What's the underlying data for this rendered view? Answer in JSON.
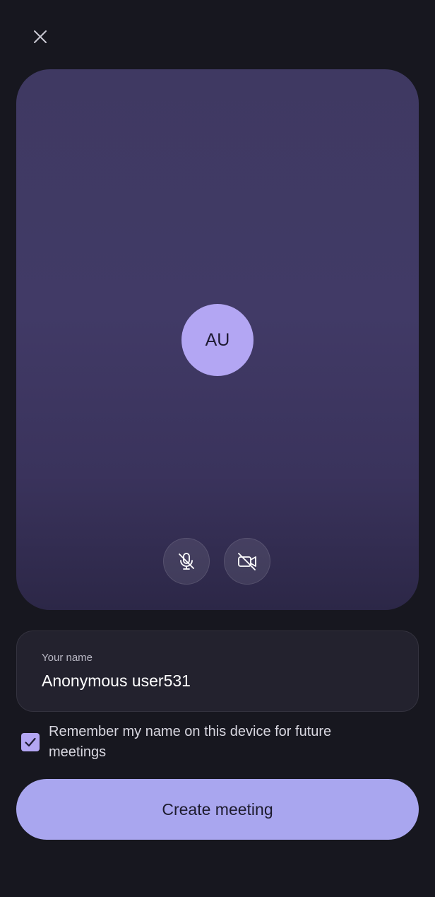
{
  "header": {
    "close_icon": "close-icon"
  },
  "preview": {
    "avatar_initials": "AU",
    "mic_icon": "mic-off-icon",
    "camera_icon": "camera-off-icon"
  },
  "name_field": {
    "label": "Your name",
    "value": "Anonymous user531"
  },
  "remember": {
    "checked": true,
    "label": "Remember my name on this device for future meetings"
  },
  "actions": {
    "create_label": "Create meeting"
  },
  "colors": {
    "background": "#17171f",
    "accent": "#b3a6f3",
    "button": "#a9a6ef"
  }
}
